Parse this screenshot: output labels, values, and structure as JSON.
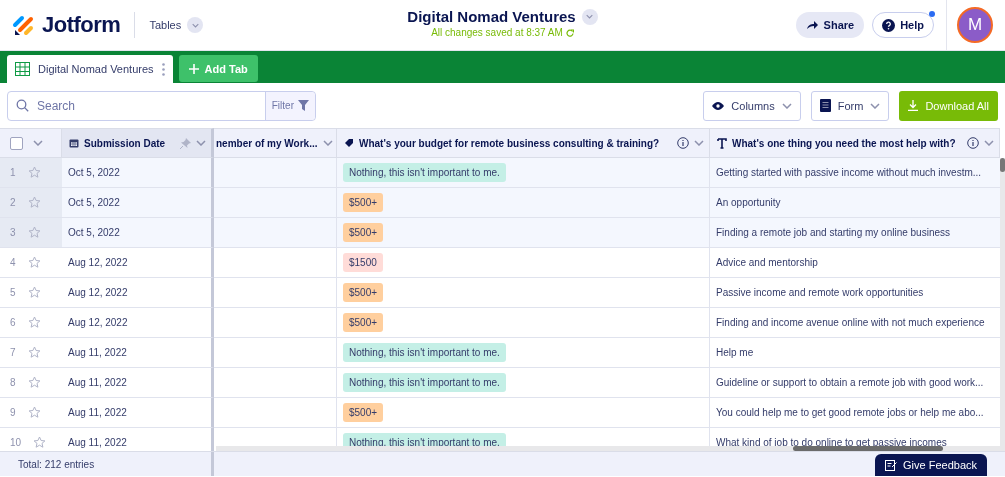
{
  "header": {
    "app": "Jotform",
    "menu": "Tables",
    "title": "Digital Nomad Ventures",
    "save_status": "All changes saved at 8:37 AM",
    "share": "Share",
    "help": "Help",
    "help_notification": true,
    "avatar": "M"
  },
  "tabs": [
    {
      "label": "Digital Nomad Ventures",
      "selected": true
    }
  ],
  "add_tab": "Add Tab",
  "toolbar": {
    "search_placeholder": "Search",
    "filter": "Filter",
    "columns": "Columns",
    "form": "Form",
    "download": "Download All"
  },
  "table": {
    "select_all_checked": false,
    "columns": [
      {
        "label": "Submission Date",
        "kind": "date"
      },
      {
        "label": "nember of my Work...",
        "kind": "plain"
      },
      {
        "label": "What's your budget for remote business consulting & training?",
        "kind": "tag"
      },
      {
        "label": "What's one thing you need the most help with?",
        "kind": "text"
      }
    ],
    "rows": [
      {
        "number": "1",
        "selected": true,
        "date": "Oct 5, 2022",
        "budget": {
          "label": "Nothing, this isn't important to me.",
          "color": "#c4efe6"
        },
        "help": "Getting started with passive income without much investm..."
      },
      {
        "number": "2",
        "selected": true,
        "date": "Oct 5, 2022",
        "budget": {
          "label": "$500+",
          "color": "#ffcf9e"
        },
        "help": "An opportunity"
      },
      {
        "number": "3",
        "selected": true,
        "date": "Oct 5, 2022",
        "budget": {
          "label": "$500+",
          "color": "#ffcf9e"
        },
        "help": "Finding a remote job and starting my online business"
      },
      {
        "number": "4",
        "selected": false,
        "date": "Aug 12, 2022",
        "budget": {
          "label": "$1500",
          "color": "#ffdcd8"
        },
        "help": "Advice and mentorship"
      },
      {
        "number": "5",
        "selected": false,
        "date": "Aug 12, 2022",
        "budget": {
          "label": "$500+",
          "color": "#ffcf9e"
        },
        "help": "Passive income and remote work opportunities"
      },
      {
        "number": "6",
        "selected": false,
        "date": "Aug 12, 2022",
        "budget": {
          "label": "$500+",
          "color": "#ffcf9e"
        },
        "help": "Finding and income avenue online with not much experience"
      },
      {
        "number": "7",
        "selected": false,
        "date": "Aug 11, 2022",
        "budget": {
          "label": "Nothing, this isn't important to me.",
          "color": "#c4efe6"
        },
        "help": "Help me"
      },
      {
        "number": "8",
        "selected": false,
        "date": "Aug 11, 2022",
        "budget": {
          "label": "Nothing, this isn't important to me.",
          "color": "#c4efe6"
        },
        "help": "Guideline or support to obtain a remote job with good work..."
      },
      {
        "number": "9",
        "selected": false,
        "date": "Aug 11, 2022",
        "budget": {
          "label": "$500+",
          "color": "#ffcf9e"
        },
        "help": "You could help me to get good remote jobs or help me abo..."
      },
      {
        "number": "10",
        "selected": false,
        "date": "Aug 11, 2022",
        "budget": {
          "label": "Nothing, this isn't important to me.",
          "color": "#c4efe6"
        },
        "help": "What kind of job to do online to get passive incomes"
      }
    ]
  },
  "footer": {
    "total": "Total: 212 entries",
    "feedback": "Give Feedback"
  }
}
